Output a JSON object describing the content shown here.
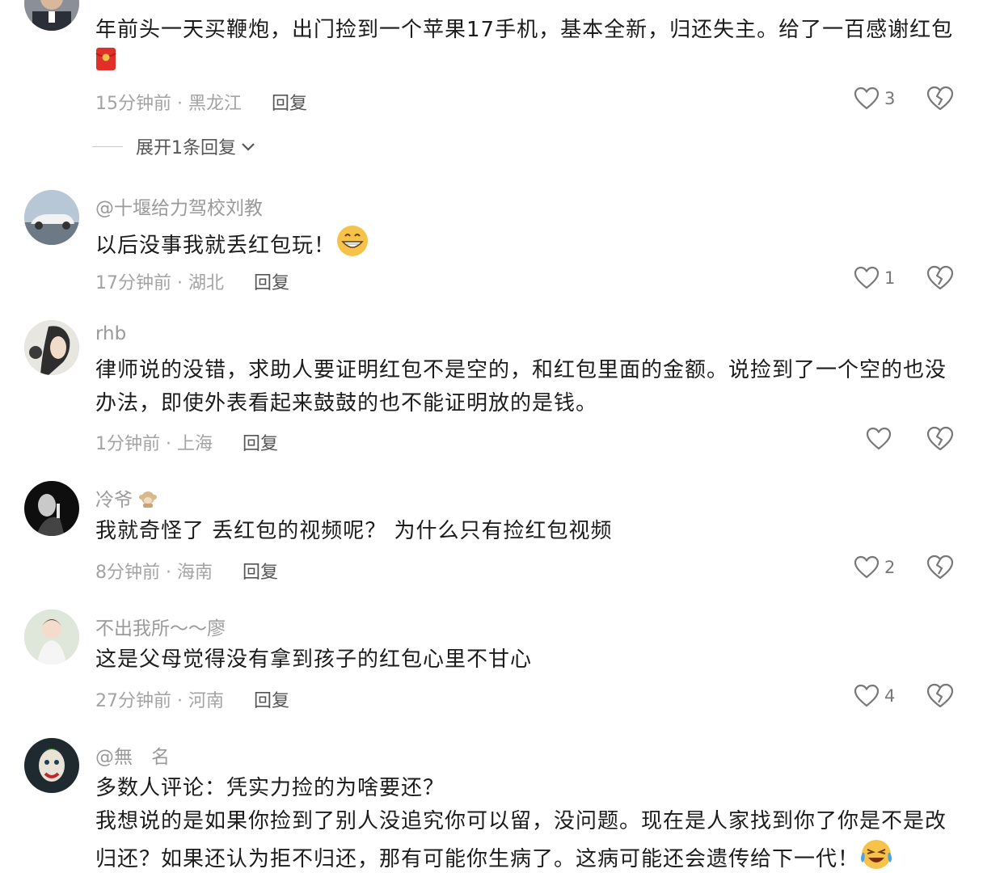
{
  "comments": [
    {
      "username": "",
      "text": "年前头一天买鞭炮，出门捡到一个苹果17手机，基本全新，归还失主。给了一百感谢红包",
      "emoji": "red-envelope",
      "time": "15分钟前",
      "location": "黑龙江",
      "reply_label": "回复",
      "likes": "3",
      "expand_label": "展开1条回复"
    },
    {
      "username": "@十堰给力驾校刘教",
      "text": "以后没事我就丢红包玩！",
      "emoji": "grin",
      "time": "17分钟前",
      "location": "湖北",
      "reply_label": "回复",
      "likes": "1"
    },
    {
      "username": "rhb",
      "text": "律师说的没错，求助人要证明红包不是空的，和红包里面的金额。说捡到了一个空的也没办法，即使外表看起来鼓鼓的也不能证明放的是钱。",
      "time": "1分钟前",
      "location": "上海",
      "reply_label": "回复",
      "likes": ""
    },
    {
      "username": "冷爷",
      "text": "我就奇怪了 丢红包的视频呢？ 为什么只有捡红包视频",
      "time": "8分钟前",
      "location": "海南",
      "reply_label": "回复",
      "likes": "2"
    },
    {
      "username": "不出我所～～廖",
      "text": "这是父母觉得没有拿到孩子的红包心里不甘心",
      "time": "27分钟前",
      "location": "河南",
      "reply_label": "回复",
      "likes": "4"
    },
    {
      "username": "@無　名",
      "text_line1": "多数人评论：凭实力捡的为啥要还？",
      "text_line2": "我想说的是如果你捡到了别人没追究你可以留，没问题。现在是人家找到你了你是不是改归还？如果还认为拒不归还，那有可能你生病了。这病可能还会遗传给下一代！",
      "emoji": "laugh-cry"
    }
  ],
  "meta_separator": " · ",
  "colors": {
    "accent_red": "#e0302a",
    "meta_gray": "#a3a3a3",
    "icon_gray": "#777777"
  }
}
